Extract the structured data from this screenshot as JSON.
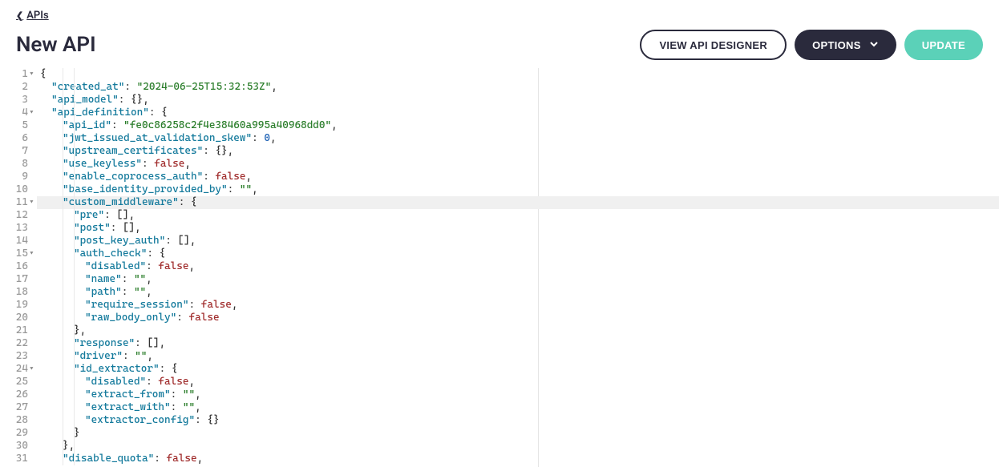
{
  "breadcrumb": {
    "label": "APIs"
  },
  "page_title": "New API",
  "buttons": {
    "designer": "VIEW API DESIGNER",
    "options": "OPTIONS",
    "update": "UPDATE"
  },
  "editor": {
    "highlighted_line": 11,
    "lines": [
      {
        "n": 1,
        "fold": true,
        "indent": 0,
        "tokens": [
          {
            "t": "punct",
            "v": "{"
          }
        ]
      },
      {
        "n": 2,
        "fold": false,
        "indent": 1,
        "tokens": [
          {
            "t": "key",
            "v": "\"created_at\""
          },
          {
            "t": "punct",
            "v": ": "
          },
          {
            "t": "string",
            "v": "\"2024-06-25T15:32:53Z\""
          },
          {
            "t": "punct",
            "v": ","
          }
        ]
      },
      {
        "n": 3,
        "fold": false,
        "indent": 1,
        "tokens": [
          {
            "t": "key",
            "v": "\"api_model\""
          },
          {
            "t": "punct",
            "v": ": {},"
          }
        ]
      },
      {
        "n": 4,
        "fold": true,
        "indent": 1,
        "tokens": [
          {
            "t": "key",
            "v": "\"api_definition\""
          },
          {
            "t": "punct",
            "v": ": {"
          }
        ]
      },
      {
        "n": 5,
        "fold": false,
        "indent": 2,
        "tokens": [
          {
            "t": "key",
            "v": "\"api_id\""
          },
          {
            "t": "punct",
            "v": ": "
          },
          {
            "t": "string",
            "v": "\"fe0c86258c2f4e38460a995a40968dd0\""
          },
          {
            "t": "punct",
            "v": ","
          }
        ]
      },
      {
        "n": 6,
        "fold": false,
        "indent": 2,
        "tokens": [
          {
            "t": "key",
            "v": "\"jwt_issued_at_validation_skew\""
          },
          {
            "t": "punct",
            "v": ": "
          },
          {
            "t": "number",
            "v": "0"
          },
          {
            "t": "punct",
            "v": ","
          }
        ]
      },
      {
        "n": 7,
        "fold": false,
        "indent": 2,
        "tokens": [
          {
            "t": "key",
            "v": "\"upstream_certificates\""
          },
          {
            "t": "punct",
            "v": ": {},"
          }
        ]
      },
      {
        "n": 8,
        "fold": false,
        "indent": 2,
        "tokens": [
          {
            "t": "key",
            "v": "\"use_keyless\""
          },
          {
            "t": "punct",
            "v": ": "
          },
          {
            "t": "bool",
            "v": "false"
          },
          {
            "t": "punct",
            "v": ","
          }
        ]
      },
      {
        "n": 9,
        "fold": false,
        "indent": 2,
        "tokens": [
          {
            "t": "key",
            "v": "\"enable_coprocess_auth\""
          },
          {
            "t": "punct",
            "v": ": "
          },
          {
            "t": "bool",
            "v": "false"
          },
          {
            "t": "punct",
            "v": ","
          }
        ]
      },
      {
        "n": 10,
        "fold": false,
        "indent": 2,
        "tokens": [
          {
            "t": "key",
            "v": "\"base_identity_provided_by\""
          },
          {
            "t": "punct",
            "v": ": "
          },
          {
            "t": "string",
            "v": "\"\""
          },
          {
            "t": "punct",
            "v": ","
          }
        ]
      },
      {
        "n": 11,
        "fold": true,
        "indent": 2,
        "tokens": [
          {
            "t": "key",
            "v": "\"custom_middleware\""
          },
          {
            "t": "punct",
            "v": ": {"
          }
        ]
      },
      {
        "n": 12,
        "fold": false,
        "indent": 3,
        "tokens": [
          {
            "t": "key",
            "v": "\"pre\""
          },
          {
            "t": "punct",
            "v": ": [],"
          }
        ]
      },
      {
        "n": 13,
        "fold": false,
        "indent": 3,
        "tokens": [
          {
            "t": "key",
            "v": "\"post\""
          },
          {
            "t": "punct",
            "v": ": [],"
          }
        ]
      },
      {
        "n": 14,
        "fold": false,
        "indent": 3,
        "tokens": [
          {
            "t": "key",
            "v": "\"post_key_auth\""
          },
          {
            "t": "punct",
            "v": ": [],"
          }
        ]
      },
      {
        "n": 15,
        "fold": true,
        "indent": 3,
        "tokens": [
          {
            "t": "key",
            "v": "\"auth_check\""
          },
          {
            "t": "punct",
            "v": ": {"
          }
        ]
      },
      {
        "n": 16,
        "fold": false,
        "indent": 4,
        "tokens": [
          {
            "t": "key",
            "v": "\"disabled\""
          },
          {
            "t": "punct",
            "v": ": "
          },
          {
            "t": "bool",
            "v": "false"
          },
          {
            "t": "punct",
            "v": ","
          }
        ]
      },
      {
        "n": 17,
        "fold": false,
        "indent": 4,
        "tokens": [
          {
            "t": "key",
            "v": "\"name\""
          },
          {
            "t": "punct",
            "v": ": "
          },
          {
            "t": "string",
            "v": "\"\""
          },
          {
            "t": "punct",
            "v": ","
          }
        ]
      },
      {
        "n": 18,
        "fold": false,
        "indent": 4,
        "tokens": [
          {
            "t": "key",
            "v": "\"path\""
          },
          {
            "t": "punct",
            "v": ": "
          },
          {
            "t": "string",
            "v": "\"\""
          },
          {
            "t": "punct",
            "v": ","
          }
        ]
      },
      {
        "n": 19,
        "fold": false,
        "indent": 4,
        "tokens": [
          {
            "t": "key",
            "v": "\"require_session\""
          },
          {
            "t": "punct",
            "v": ": "
          },
          {
            "t": "bool",
            "v": "false"
          },
          {
            "t": "punct",
            "v": ","
          }
        ]
      },
      {
        "n": 20,
        "fold": false,
        "indent": 4,
        "tokens": [
          {
            "t": "key",
            "v": "\"raw_body_only\""
          },
          {
            "t": "punct",
            "v": ": "
          },
          {
            "t": "bool",
            "v": "false"
          }
        ]
      },
      {
        "n": 21,
        "fold": false,
        "indent": 3,
        "tokens": [
          {
            "t": "punct",
            "v": "},"
          }
        ]
      },
      {
        "n": 22,
        "fold": false,
        "indent": 3,
        "tokens": [
          {
            "t": "key",
            "v": "\"response\""
          },
          {
            "t": "punct",
            "v": ": [],"
          }
        ]
      },
      {
        "n": 23,
        "fold": false,
        "indent": 3,
        "tokens": [
          {
            "t": "key",
            "v": "\"driver\""
          },
          {
            "t": "punct",
            "v": ": "
          },
          {
            "t": "string",
            "v": "\"\""
          },
          {
            "t": "punct",
            "v": ","
          }
        ]
      },
      {
        "n": 24,
        "fold": true,
        "indent": 3,
        "tokens": [
          {
            "t": "key",
            "v": "\"id_extractor\""
          },
          {
            "t": "punct",
            "v": ": {"
          }
        ]
      },
      {
        "n": 25,
        "fold": false,
        "indent": 4,
        "tokens": [
          {
            "t": "key",
            "v": "\"disabled\""
          },
          {
            "t": "punct",
            "v": ": "
          },
          {
            "t": "bool",
            "v": "false"
          },
          {
            "t": "punct",
            "v": ","
          }
        ]
      },
      {
        "n": 26,
        "fold": false,
        "indent": 4,
        "tokens": [
          {
            "t": "key",
            "v": "\"extract_from\""
          },
          {
            "t": "punct",
            "v": ": "
          },
          {
            "t": "string",
            "v": "\"\""
          },
          {
            "t": "punct",
            "v": ","
          }
        ]
      },
      {
        "n": 27,
        "fold": false,
        "indent": 4,
        "tokens": [
          {
            "t": "key",
            "v": "\"extract_with\""
          },
          {
            "t": "punct",
            "v": ": "
          },
          {
            "t": "string",
            "v": "\"\""
          },
          {
            "t": "punct",
            "v": ","
          }
        ]
      },
      {
        "n": 28,
        "fold": false,
        "indent": 4,
        "tokens": [
          {
            "t": "key",
            "v": "\"extractor_config\""
          },
          {
            "t": "punct",
            "v": ": {}"
          }
        ]
      },
      {
        "n": 29,
        "fold": false,
        "indent": 3,
        "tokens": [
          {
            "t": "punct",
            "v": "}"
          }
        ]
      },
      {
        "n": 30,
        "fold": false,
        "indent": 2,
        "tokens": [
          {
            "t": "punct",
            "v": "},"
          }
        ]
      },
      {
        "n": 31,
        "fold": false,
        "indent": 2,
        "tokens": [
          {
            "t": "key",
            "v": "\"disable_quota\""
          },
          {
            "t": "punct",
            "v": ": "
          },
          {
            "t": "bool",
            "v": "false"
          },
          {
            "t": "punct",
            "v": ","
          }
        ]
      }
    ]
  }
}
